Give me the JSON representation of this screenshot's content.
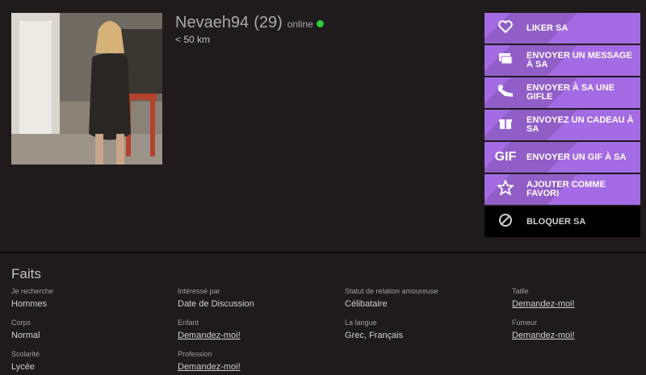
{
  "profile": {
    "name": "Nevaeh94",
    "age": "(29)",
    "status": "online",
    "distance": "< 50 km"
  },
  "actions": [
    {
      "icon": "heart-icon",
      "label": "LIKER SA"
    },
    {
      "icon": "message-icon",
      "label": "ENVOYER UN MESSAGE À SA"
    },
    {
      "icon": "slap-icon",
      "label": "ENVOYER À SA UNE GIFLE"
    },
    {
      "icon": "gift-icon",
      "label": "ENVOYEZ UN CADEAU À SA"
    },
    {
      "icon": "gif-icon",
      "label": "ENVOYER UN GIF À SA",
      "glyph": "GIF"
    },
    {
      "icon": "star-icon",
      "label": "AJOUTER COMME FAVORI"
    },
    {
      "icon": "block-icon",
      "label": "BLOQUER SA"
    }
  ],
  "facts": {
    "title": "Faits",
    "items": [
      {
        "key": "Je recherche",
        "value": "Hommes"
      },
      {
        "key": "Intéressé par",
        "value": "Date de Discussion"
      },
      {
        "key": "Statut de relation amoureuse",
        "value": "Célibataire"
      },
      {
        "key": "Taille",
        "value": "Demandez-moi!"
      },
      {
        "key": "Corps",
        "value": "Normal"
      },
      {
        "key": "Enfant",
        "value": "Demandez-moi!"
      },
      {
        "key": "La langue",
        "value": "Grec, Français"
      },
      {
        "key": "Fumeur",
        "value": "Demandez-moi!"
      },
      {
        "key": "Scolarité",
        "value": "Lycée"
      },
      {
        "key": "Profession",
        "value": "Demandez-moi!"
      }
    ]
  },
  "colors": {
    "background": "#1f1b1c",
    "accent": "#a56be4",
    "online": "#2ecc40",
    "block_bg": "#000000"
  }
}
